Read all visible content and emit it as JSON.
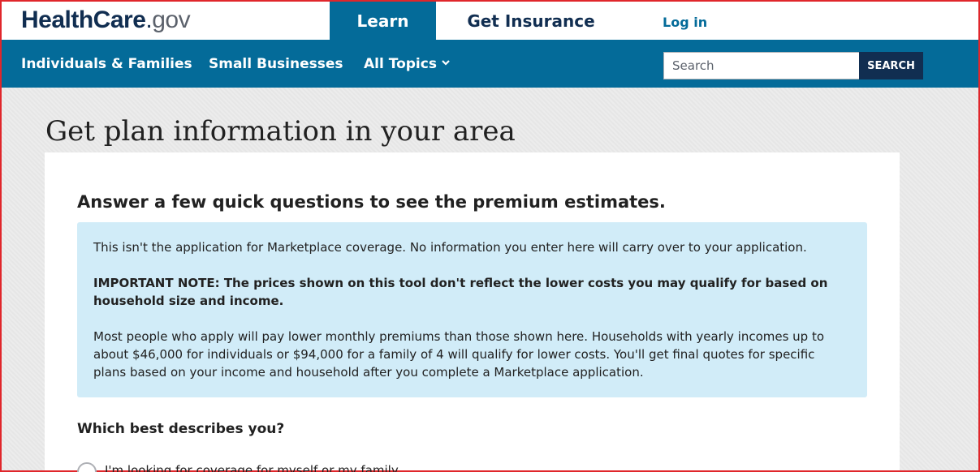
{
  "header": {
    "logo_brand": "HealthCare",
    "logo_dot": ".",
    "logo_tld": "gov",
    "tab_learn": "Learn",
    "tab_get_insurance": "Get Insurance",
    "login": "Log in"
  },
  "nav": {
    "individuals": "Individuals & Families",
    "small_businesses": "Small Businesses",
    "all_topics": "All Topics",
    "search_placeholder": "Search",
    "search_button": "SEARCH"
  },
  "main": {
    "page_title": "Get plan information in your area",
    "card_heading": "Answer a few quick questions to see the premium estimates.",
    "info": {
      "p1": "This isn't the application for Marketplace coverage. No information you enter here will carry over to your application.",
      "p2": "IMPORTANT NOTE: The prices shown on this tool don't reflect the lower costs you may qualify for based on household size and income.",
      "p3": "Most people who apply will pay lower monthly premiums than those shown here. Households with yearly incomes up to about $46,000 for individuals or $94,000 for a family of 4 will qualify for lower costs. You'll get final quotes for specific plans based on your income and household after you complete a Marketplace application."
    },
    "question": "Which best describes you?",
    "option_1": "I'm looking for coverage for myself or my family"
  },
  "colors": {
    "primary": "#046b99",
    "dark_navy": "#112e51",
    "info_bg": "#d1ecf8",
    "frame_border": "#e0262b"
  }
}
